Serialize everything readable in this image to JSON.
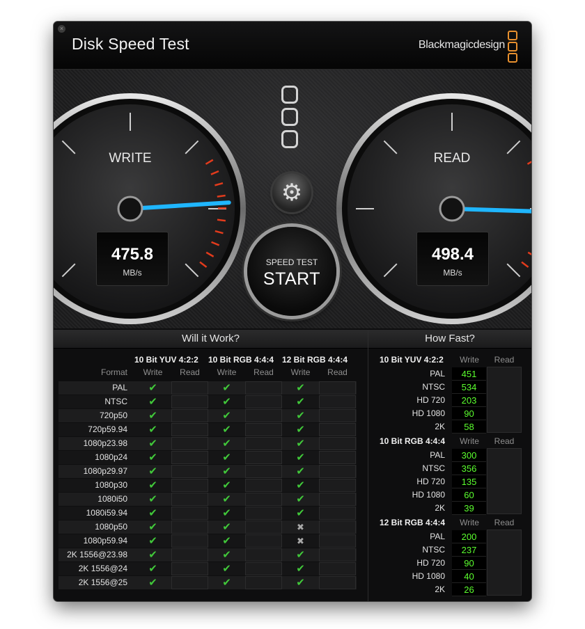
{
  "window": {
    "title": "Disk Speed Test",
    "brand": "Blackmagicdesign",
    "close_glyph": "×",
    "accent_color": "#e8902e"
  },
  "gauges": {
    "write": {
      "label": "WRITE",
      "value": "475.8",
      "unit": "MB/s",
      "needle_fraction": 0.82
    },
    "read": {
      "label": "READ",
      "value": "498.4",
      "unit": "MB/s",
      "needle_fraction": 0.84
    },
    "needle_color": "#1fb6ff",
    "redline_color": "#e23b1c"
  },
  "controls": {
    "settings_icon": "gear-icon",
    "start_small": "SPEED TEST",
    "start_big": "START"
  },
  "will_it_work": {
    "title": "Will it Work?",
    "format_header": "Format",
    "groups": [
      "10 Bit YUV 4:2:2",
      "10 Bit RGB 4:4:4",
      "12 Bit RGB 4:4:4"
    ],
    "subheaders": [
      "Write",
      "Read"
    ],
    "yes_glyph": "✔",
    "no_glyph": "✖",
    "rows": [
      {
        "format": "PAL",
        "marks": [
          true,
          true,
          true
        ]
      },
      {
        "format": "NTSC",
        "marks": [
          true,
          true,
          true
        ]
      },
      {
        "format": "720p50",
        "marks": [
          true,
          true,
          true
        ]
      },
      {
        "format": "720p59.94",
        "marks": [
          true,
          true,
          true
        ]
      },
      {
        "format": "1080p23.98",
        "marks": [
          true,
          true,
          true
        ]
      },
      {
        "format": "1080p24",
        "marks": [
          true,
          true,
          true
        ]
      },
      {
        "format": "1080p29.97",
        "marks": [
          true,
          true,
          true
        ]
      },
      {
        "format": "1080p30",
        "marks": [
          true,
          true,
          true
        ]
      },
      {
        "format": "1080i50",
        "marks": [
          true,
          true,
          true
        ]
      },
      {
        "format": "1080i59.94",
        "marks": [
          true,
          true,
          true
        ]
      },
      {
        "format": "1080p50",
        "marks": [
          true,
          true,
          false
        ]
      },
      {
        "format": "1080p59.94",
        "marks": [
          true,
          true,
          false
        ]
      },
      {
        "format": "2K 1556@23.98",
        "marks": [
          true,
          true,
          true
        ]
      },
      {
        "format": "2K 1556@24",
        "marks": [
          true,
          true,
          true
        ]
      },
      {
        "format": "2K 1556@25",
        "marks": [
          true,
          true,
          true
        ]
      }
    ]
  },
  "how_fast": {
    "title": "How Fast?",
    "subheaders": [
      "Write",
      "Read"
    ],
    "sections": [
      {
        "name": "10 Bit YUV 4:2:2",
        "rows": [
          {
            "format": "PAL",
            "write": "451"
          },
          {
            "format": "NTSC",
            "write": "534"
          },
          {
            "format": "HD 720",
            "write": "203"
          },
          {
            "format": "HD 1080",
            "write": "90"
          },
          {
            "format": "2K",
            "write": "58"
          }
        ]
      },
      {
        "name": "10 Bit RGB 4:4:4",
        "rows": [
          {
            "format": "PAL",
            "write": "300"
          },
          {
            "format": "NTSC",
            "write": "356"
          },
          {
            "format": "HD 720",
            "write": "135"
          },
          {
            "format": "HD 1080",
            "write": "60"
          },
          {
            "format": "2K",
            "write": "39"
          }
        ]
      },
      {
        "name": "12 Bit RGB 4:4:4",
        "rows": [
          {
            "format": "PAL",
            "write": "200"
          },
          {
            "format": "NTSC",
            "write": "237"
          },
          {
            "format": "HD 720",
            "write": "90"
          },
          {
            "format": "HD 1080",
            "write": "40"
          },
          {
            "format": "2K",
            "write": "26"
          }
        ]
      }
    ]
  }
}
